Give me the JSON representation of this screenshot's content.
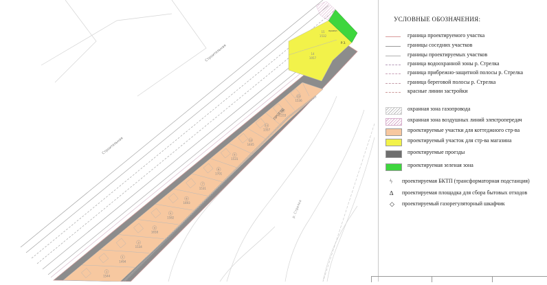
{
  "legend": {
    "title": "УСЛОВНЫЕ ОБОЗНАЧЕНИЯ:",
    "lines": [
      {
        "label": "граница проектируемого участка",
        "color": "#d99a9a",
        "style": "solid"
      },
      {
        "label": "границы соседних участков",
        "color": "#9a9a9a",
        "style": "solid"
      },
      {
        "label": "границы проектируемых участков",
        "color": "#b0b0b0",
        "style": "solid"
      },
      {
        "label": "граница водоохранной зоны р. Стрелка",
        "color": "#b59ab8",
        "style": "dashed"
      },
      {
        "label": "граница прибрежно-защитной полосы р. Стрелка",
        "color": "#c7a0b8",
        "style": "dashed"
      },
      {
        "label": "граница береговой полосы р. Стрелка",
        "color": "#c49aa8",
        "style": "dashed"
      },
      {
        "label": "красные линии застройки",
        "color": "#c99",
        "style": "dashdot"
      }
    ],
    "areas": [
      {
        "label": "охранная зона газопровода",
        "kind": "hatch-gray"
      },
      {
        "label": "охранная зона воздушных линий электропередач",
        "kind": "hatch-pink"
      },
      {
        "label": "проектируемые участки для коттеджного стр-ва",
        "color": "#f7c8a0"
      },
      {
        "label": "проектируемый участок для стр-ва магазина",
        "color": "#f2f24a"
      },
      {
        "label": "проектируемые проезды",
        "color": "#6e6e6e"
      },
      {
        "label": "проектируемая зеленая зона",
        "color": "#3ed63e"
      }
    ],
    "symbols": [
      {
        "label": "проектируемая БКТП (трансформаторная подстанция)",
        "icon": "transformer-icon",
        "glyph": "ϟ"
      },
      {
        "label": "проектируемая площадка для сбора бытовых отходов",
        "icon": "waste-site-icon",
        "glyph": "∆"
      },
      {
        "label": "проектируемый газорегуляторный шкафчик",
        "icon": "gas-cabinet-icon",
        "glyph": "◇"
      }
    ]
  },
  "map": {
    "colors": {
      "plot": "#f7c8a0",
      "shop": "#f2f24a",
      "road": "#8c8c8c",
      "green": "#3ed63e",
      "grid": "#b9b9b9"
    },
    "plots": [
      {
        "num": "1",
        "area": "1544"
      },
      {
        "num": "2",
        "area": "1494"
      },
      {
        "num": "3",
        "area": "1534"
      },
      {
        "num": "4",
        "area": "1658"
      },
      {
        "num": "5",
        "area": "1582"
      },
      {
        "num": "6",
        "area": "1693"
      },
      {
        "num": "7",
        "area": "1531"
      },
      {
        "num": "8",
        "area": "1701"
      },
      {
        "num": "9",
        "area": "1531"
      },
      {
        "num": "10",
        "area": "1445"
      },
      {
        "num": "11",
        "area": "1357"
      },
      {
        "num": "12",
        "area": "1333"
      },
      {
        "num": "13",
        "area": "1536"
      }
    ],
    "shop_plot": {
      "num": "14",
      "area": "1057"
    },
    "north_plot": {
      "num": "15",
      "area": "1532"
    },
    "green_label": "Р.З.",
    "road_label": "проезд"
  }
}
